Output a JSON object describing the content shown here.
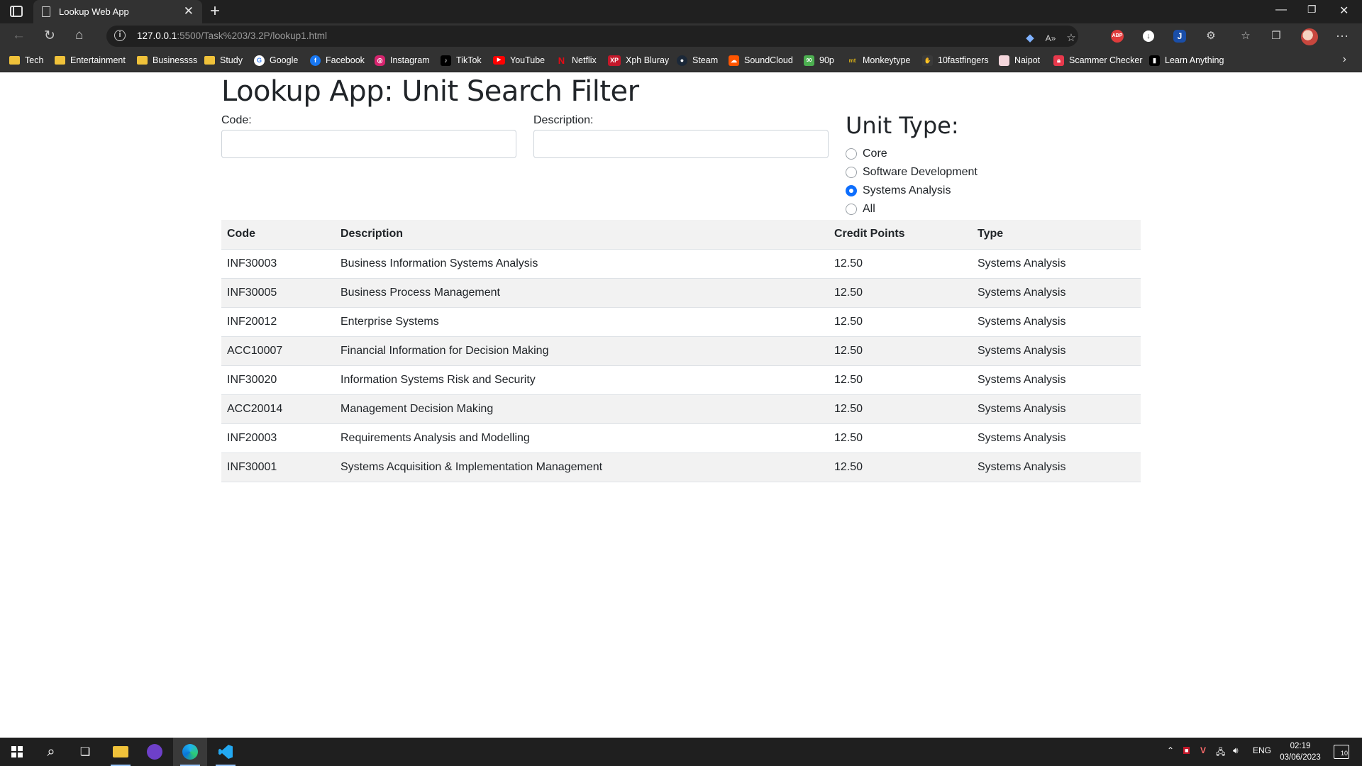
{
  "browser": {
    "tab_title": "Lookup Web App",
    "url_host": "127.0.0.1",
    "url_rest": ":5500/Task%203/3.2P/lookup1.html"
  },
  "bookmarks": [
    {
      "label": "Tech",
      "icon": "folder-icon"
    },
    {
      "label": "Entertainment",
      "icon": "folder-icon"
    },
    {
      "label": "Businessss",
      "icon": "folder-icon"
    },
    {
      "label": "Study",
      "icon": "folder-icon"
    },
    {
      "label": "Google",
      "icon": "google-icon"
    },
    {
      "label": "Facebook",
      "icon": "facebook-icon"
    },
    {
      "label": "Instagram",
      "icon": "instagram-icon"
    },
    {
      "label": "TikTok",
      "icon": "tiktok-icon"
    },
    {
      "label": "YouTube",
      "icon": "youtube-icon"
    },
    {
      "label": "Netflix",
      "icon": "netflix-icon"
    },
    {
      "label": "Xph Bluray",
      "icon": "xph-icon"
    },
    {
      "label": "Steam",
      "icon": "steam-icon"
    },
    {
      "label": "SoundCloud",
      "icon": "soundcloud-icon"
    },
    {
      "label": "90p",
      "icon": "90p-icon"
    },
    {
      "label": "Monkeytype",
      "icon": "monkeytype-icon"
    },
    {
      "label": "10fastfingers",
      "icon": "10fastfingers-icon"
    },
    {
      "label": "Naipot",
      "icon": "naipot-icon"
    },
    {
      "label": "Scammer Checker",
      "icon": "lock-icon"
    },
    {
      "label": "Learn Anything",
      "icon": "learn-anything-icon"
    }
  ],
  "page": {
    "title": "Lookup App: Unit Search Filter",
    "code_label": "Code:",
    "code_value": "",
    "description_label": "Description:",
    "description_value": "",
    "unit_type_heading": "Unit Type:",
    "unit_type_options": [
      {
        "label": "Core",
        "checked": false
      },
      {
        "label": "Software Development",
        "checked": false
      },
      {
        "label": "Systems Analysis",
        "checked": true
      },
      {
        "label": "All",
        "checked": false
      }
    ],
    "table": {
      "headers": [
        "Code",
        "Description",
        "Credit Points",
        "Type"
      ],
      "rows": [
        [
          "INF30003",
          "Business Information Systems Analysis",
          "12.50",
          "Systems Analysis"
        ],
        [
          "INF30005",
          "Business Process Management",
          "12.50",
          "Systems Analysis"
        ],
        [
          "INF20012",
          "Enterprise Systems",
          "12.50",
          "Systems Analysis"
        ],
        [
          "ACC10007",
          "Financial Information for Decision Making",
          "12.50",
          "Systems Analysis"
        ],
        [
          "INF30020",
          "Information Systems Risk and Security",
          "12.50",
          "Systems Analysis"
        ],
        [
          "ACC20014",
          "Management Decision Making",
          "12.50",
          "Systems Analysis"
        ],
        [
          "INF20003",
          "Requirements Analysis and Modelling",
          "12.50",
          "Systems Analysis"
        ],
        [
          "INF30001",
          "Systems Acquisition & Implementation Management",
          "12.50",
          "Systems Analysis"
        ]
      ]
    }
  },
  "taskbar": {
    "language": "ENG",
    "time": "02:19",
    "date": "03/06/2023",
    "notification_count": "10"
  },
  "colors": {
    "accent": "#0d6efd",
    "row_stripe": "#f2f2f2",
    "chrome_dark": "#202020",
    "chrome_toolbar": "#323232"
  }
}
